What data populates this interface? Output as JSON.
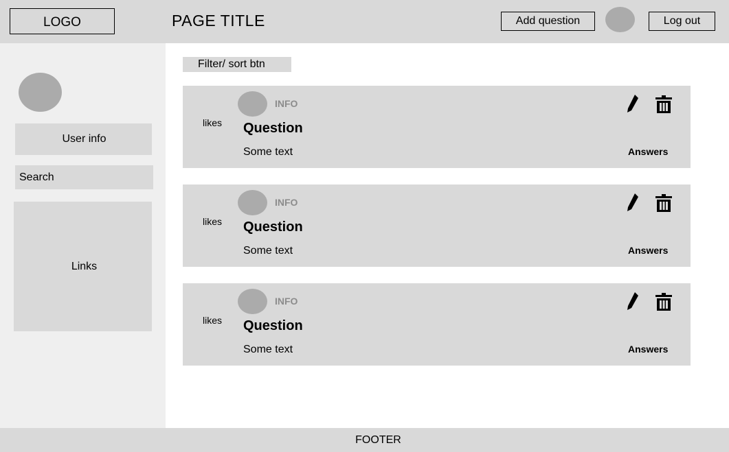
{
  "header": {
    "logo": "LOGO",
    "title": "PAGE TITLE",
    "add_question": "Add question",
    "logout": "Log out"
  },
  "sidebar": {
    "user_info": "User info",
    "search": "Search",
    "links": "Links"
  },
  "main": {
    "filter_btn": "Filter/ sort btn",
    "questions": [
      {
        "likes": "likes",
        "info": "INFO",
        "title": "Question",
        "text": "Some text",
        "answers": "Answers"
      },
      {
        "likes": "likes",
        "info": "INFO",
        "title": "Question",
        "text": "Some text",
        "answers": "Answers"
      },
      {
        "likes": "likes",
        "info": "INFO",
        "title": "Question",
        "text": "Some text",
        "answers": "Answers"
      }
    ]
  },
  "footer": "FOOTER",
  "icons": {
    "edit": "pencil-icon",
    "delete": "trash-icon"
  },
  "colors": {
    "header_bg": "#d9d9d9",
    "sidebar_bg": "#efefef",
    "avatar": "#ababab",
    "card_bg": "#d9d9d9"
  }
}
